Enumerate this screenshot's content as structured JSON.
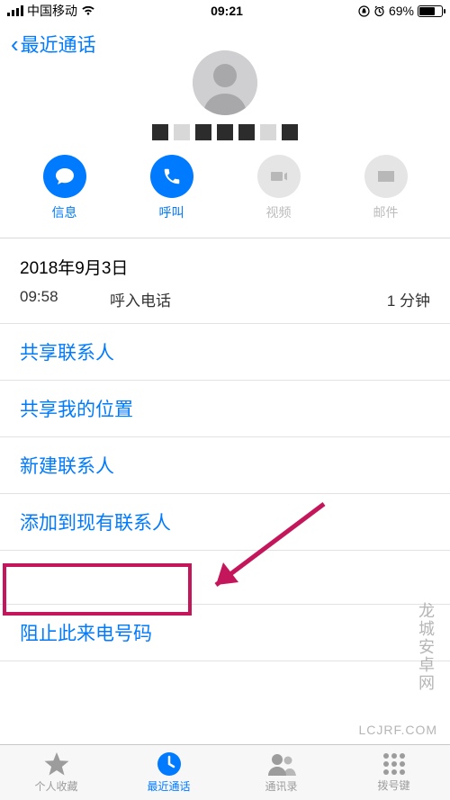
{
  "statusBar": {
    "carrier": "中国移动",
    "time": "09:21",
    "battery": "69%"
  },
  "header": {
    "backLabel": "最近通话"
  },
  "actions": {
    "message": "信息",
    "call": "呼叫",
    "video": "视频",
    "mail": "邮件"
  },
  "callLog": {
    "date": "2018年9月3日",
    "time": "09:58",
    "type": "呼入电话",
    "duration": "1 分钟"
  },
  "listItems": {
    "shareContact": "共享联系人",
    "shareLocation": "共享我的位置",
    "newContact": "新建联系人",
    "addToExisting": "添加到现有联系人",
    "blockCaller": "阻止此来电号码"
  },
  "tabs": {
    "favorites": "个人收藏",
    "recents": "最近通话",
    "contacts": "通讯录",
    "keypad": "拨号键"
  },
  "watermark": {
    "text": "龙城安卓网",
    "url": "LCJRF.COM"
  }
}
